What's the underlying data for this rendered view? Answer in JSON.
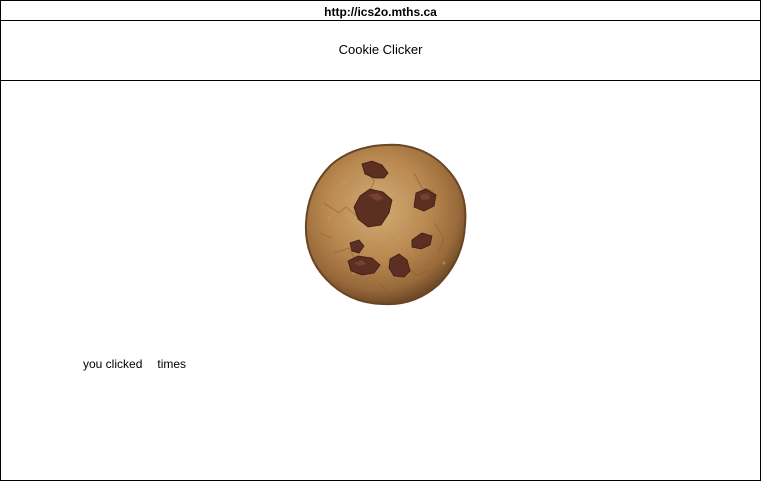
{
  "browser": {
    "url": "http://ics2o.mths.ca"
  },
  "page": {
    "title": "Cookie Clicker"
  },
  "cookie": {
    "icon": "cookie-icon"
  },
  "counter": {
    "prefix": "you clicked",
    "count": "",
    "suffix": "times"
  }
}
